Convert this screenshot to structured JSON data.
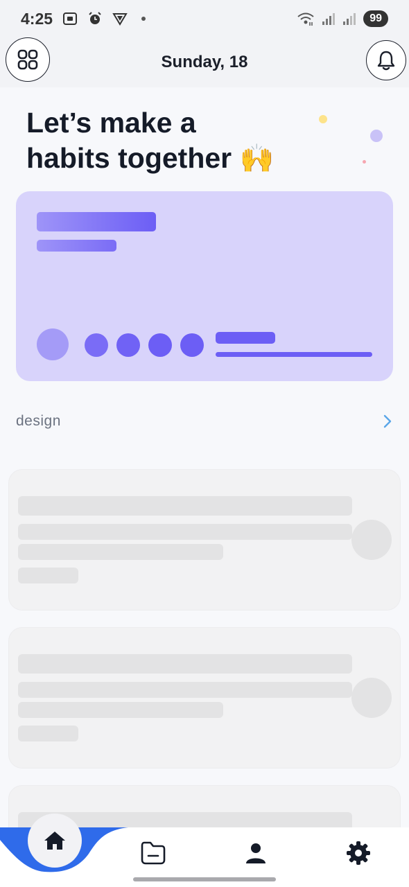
{
  "status_bar": {
    "time": "4:25",
    "battery": "99"
  },
  "header": {
    "title": "Sunday, 18"
  },
  "headline": {
    "line1": "Let’s make a",
    "line2": "habits together",
    "emoji": "🙌"
  },
  "category": {
    "label": "design"
  },
  "colors": {
    "accent": "#6c5ef5",
    "hero_bg": "#d8d3fb",
    "nav_blue": "#2f6bea",
    "dark": "#151b28"
  },
  "icons": {
    "menu": "grid-icon",
    "notifications": "bell-icon",
    "arrow": "chevron-right-icon",
    "home": "home-icon",
    "folder": "folder-icon",
    "profile": "user-icon",
    "settings": "gear-icon"
  }
}
